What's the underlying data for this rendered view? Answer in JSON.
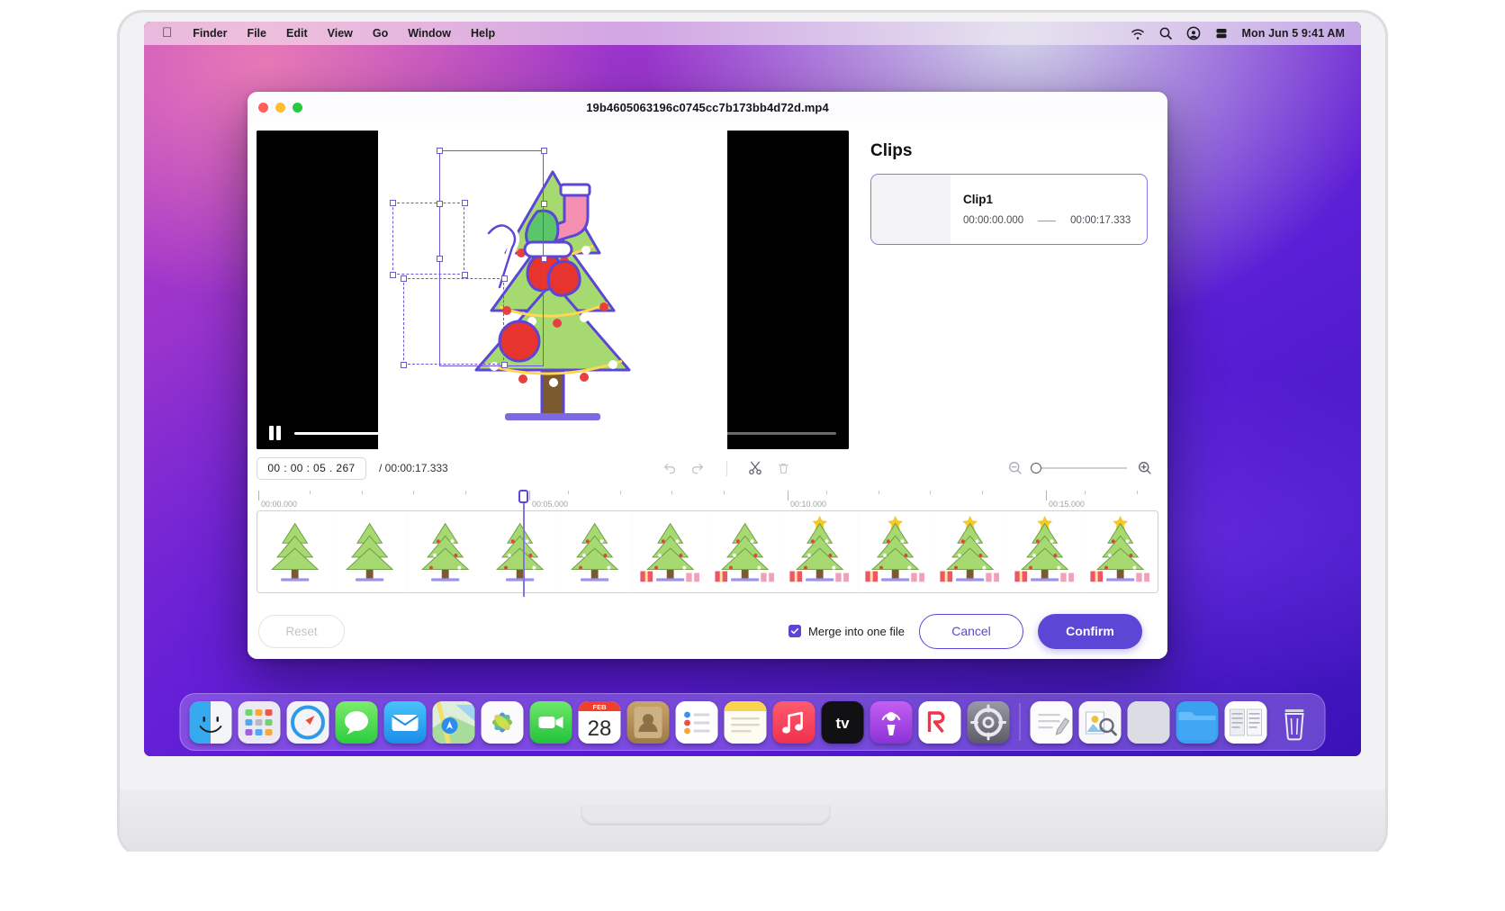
{
  "menubar": {
    "apple": "apple-logo",
    "items": [
      "Finder",
      "File",
      "Edit",
      "View",
      "Go",
      "Window",
      "Help"
    ],
    "status_icons": [
      "wifi-icon",
      "search-icon",
      "control-center-icon",
      "battery-icon"
    ],
    "clock": "Mon Jun 5  9:41 AM"
  },
  "window": {
    "title": "19b4605063196c0745cc7b173bb4d72d.mp4",
    "traffic_lights": [
      "close-button",
      "minimize-button",
      "zoom-button"
    ]
  },
  "player": {
    "pause_label": "pause-icon",
    "progress_percent": 30.4
  },
  "clips": {
    "heading": "Clips",
    "items": [
      {
        "name": "Clip1",
        "start": "00:00:00.000",
        "end": "00:00:17.333",
        "separator": "—"
      }
    ]
  },
  "toolbar": {
    "timecode_value": "00 : 00 : 05 . 267",
    "duration_label": "/ 00:00:17.333",
    "undo_label": "undo-icon",
    "redo_label": "redo-icon",
    "cut_label": "scissors-icon",
    "delete_label": "trash-icon",
    "zoom_out_label": "zoom-out-icon",
    "zoom_in_label": "zoom-in-icon",
    "zoom_slider_value": 0
  },
  "timeline": {
    "ruler_labels": [
      "00:00.000",
      "00:05.000",
      "00:10.000",
      "00:15.000"
    ],
    "playhead_time": "00:00:05.267",
    "frame_count": 12
  },
  "footer": {
    "reset_label": "Reset",
    "merge_label": "Merge into one file",
    "merge_checked": true,
    "cancel_label": "Cancel",
    "confirm_label": "Confirm"
  },
  "dock": {
    "icons": [
      "finder-icon",
      "launchpad-icon",
      "safari-icon",
      "messages-icon",
      "mail-icon",
      "maps-icon",
      "photos-icon",
      "facetime-icon",
      "calendar-icon",
      "contacts-icon",
      "reminders-icon",
      "notes-icon",
      "music-icon",
      "appletv-icon",
      "podcasts-icon",
      "news-icon",
      "settings-icon",
      "separator",
      "textedit-icon",
      "preview-icon",
      "folder-blank-icon",
      "downloads-folder-icon",
      "pages-icon",
      "trash-icon"
    ],
    "calendar_month": "FEB",
    "calendar_day": "28"
  },
  "colors": {
    "accent": "#5b46d6",
    "accent_light": "#8c72ee",
    "tree_green": "#9ed36a",
    "tree_stroke": "#5b46d6"
  }
}
